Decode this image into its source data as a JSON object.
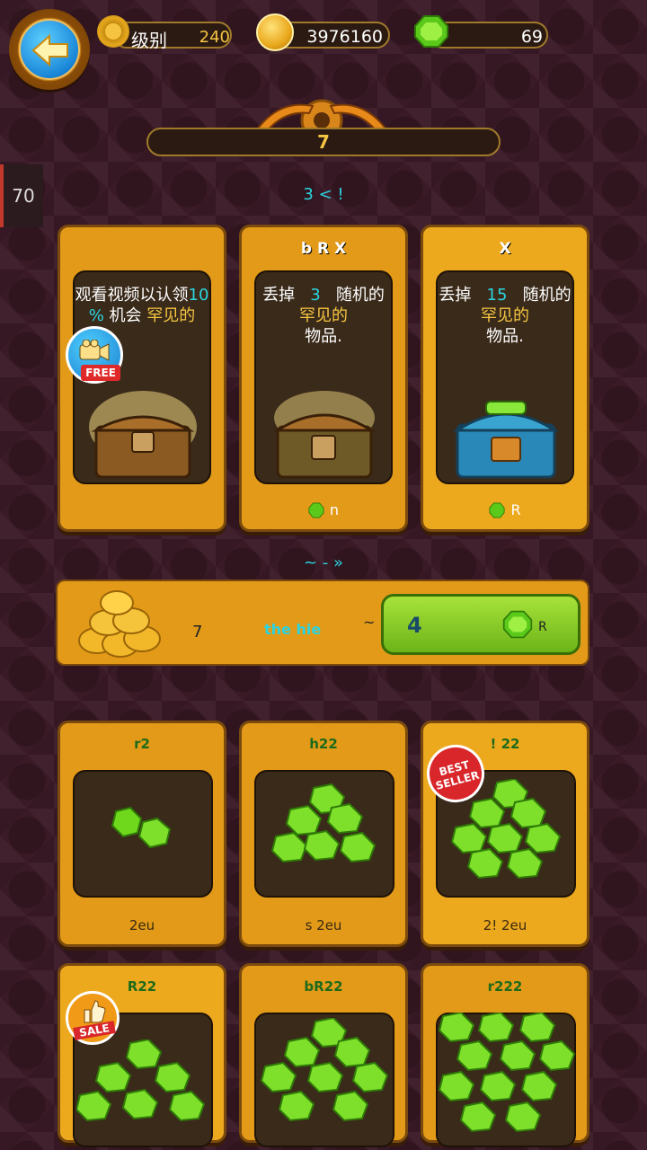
{
  "top_bar": {
    "level_label": "级别",
    "level_value": "240",
    "coins": "3976160",
    "gems": "69"
  },
  "title": "7",
  "side_tab": "70",
  "section1_label": "3 < !",
  "chests": [
    {
      "header": "",
      "desc_line1": "观看视频以认领",
      "desc_num": "10",
      "desc_pct": "%",
      "desc_mid": "机会",
      "desc_rare": "罕见的",
      "free_label": "FREE",
      "price": ""
    },
    {
      "header": "b R X",
      "desc_pre": "丢掉",
      "desc_num": "3",
      "desc_post": "随机的",
      "desc_rare": "罕见的",
      "desc_items": "物品.",
      "price": "n"
    },
    {
      "header": "X",
      "desc_pre": "丢掉",
      "desc_num": "15",
      "desc_post": "随机的",
      "desc_rare": "罕见的",
      "desc_items": "物品.",
      "price": "R"
    }
  ],
  "section2_label": "~ -   »",
  "exchange": {
    "amount": "7",
    "label": "the hie",
    "sep": "~ :",
    "button_value": "4",
    "button_price": "R"
  },
  "packs": [
    {
      "title": "r2",
      "price": "2eu",
      "badge": ""
    },
    {
      "title": "h22",
      "price": "s 2eu",
      "badge": ""
    },
    {
      "title": "! 22",
      "price": "2! 2eu",
      "badge": "BEST SELLER"
    },
    {
      "title": "R22",
      "price": "",
      "badge": "SALE"
    },
    {
      "title": "bR22",
      "price": "",
      "badge": ""
    },
    {
      "title": "r222",
      "price": "",
      "badge": ""
    }
  ],
  "colors": {
    "accent_gold": "#f5c542",
    "accent_cyan": "#2bd4e0",
    "card_orange": "#e29a18",
    "gem_green": "#7ee02a"
  }
}
